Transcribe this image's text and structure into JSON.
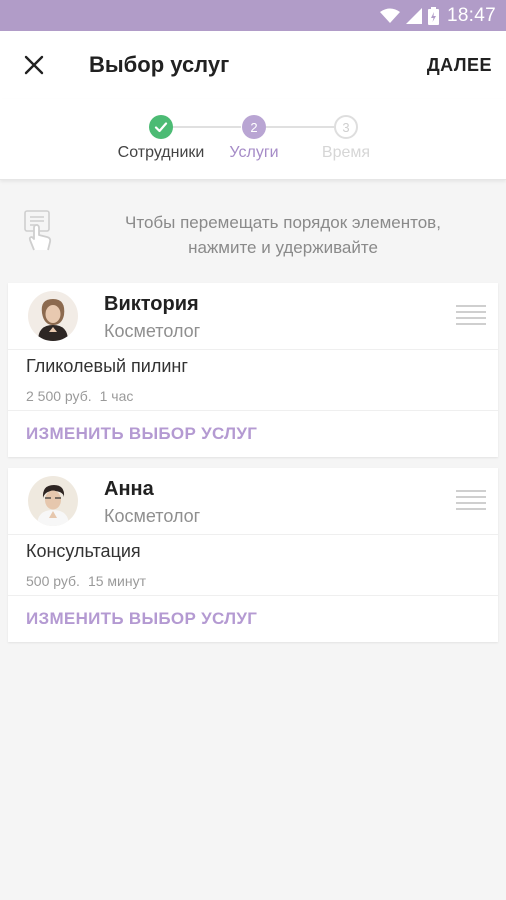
{
  "status_bar": {
    "time": "18:47",
    "icons": [
      "wifi-icon",
      "signal-icon",
      "battery-icon"
    ],
    "background": "#b19cc8"
  },
  "header": {
    "close_icon": "close-icon",
    "title": "Выбор услуг",
    "next_label": "ДАЛЕЕ"
  },
  "stepper": {
    "steps": [
      {
        "number": "1",
        "label": "Сотрудники",
        "state": "done"
      },
      {
        "number": "2",
        "label": "Услуги",
        "state": "active"
      },
      {
        "number": "3",
        "label": "Время",
        "state": "todo"
      }
    ],
    "colors": {
      "done": "#4cbb74",
      "active": "#b9a5d3",
      "todo": "#dedede"
    }
  },
  "hint": {
    "icon": "touch-hold-icon",
    "text_line1": "Чтобы перемещать порядок элементов,",
    "text_line2": "нажмите и удерживайте"
  },
  "staff": [
    {
      "name": "Виктория",
      "role": "Косметолог",
      "service": "Гликолевый пилинг",
      "price": "2 500 руб.",
      "duration": "1 час",
      "change_label": "ИЗМЕНИТЬ ВЫБОР УСЛУГ"
    },
    {
      "name": "Анна",
      "role": "Косметолог",
      "service": "Консультация",
      "price": "500 руб.",
      "duration": "15 минут",
      "change_label": "ИЗМЕНИТЬ ВЫБОР УСЛУГ"
    }
  ],
  "accent_color": "#b49ad2"
}
